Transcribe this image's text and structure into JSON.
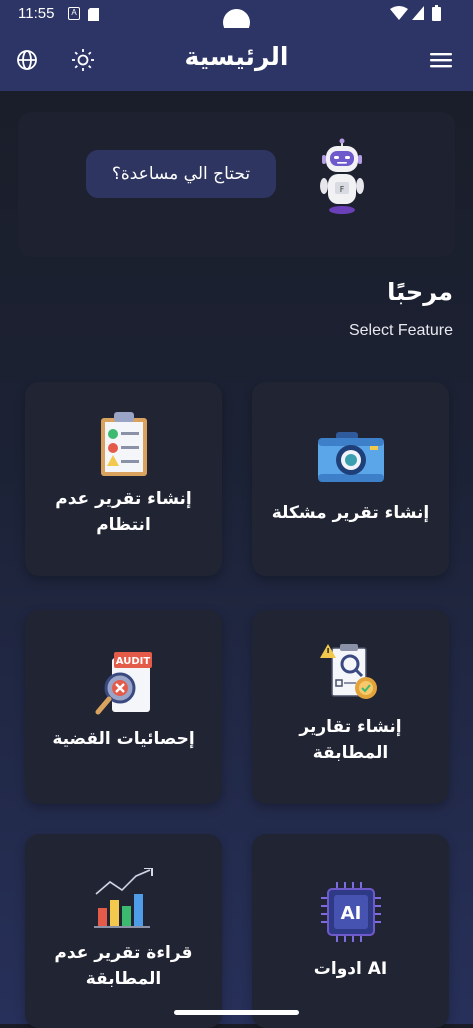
{
  "status_bar": {
    "time": "11:55",
    "notif_a": "A"
  },
  "app_bar": {
    "title": "الرئيسية"
  },
  "help": {
    "bubble_text": "تحتاج الي مساعدة؟"
  },
  "welcome": {
    "title": "مرحبًا",
    "subtitle": "Select Feature"
  },
  "features": [
    {
      "label": "إنشاء تقرير مشكلة",
      "icon": "camera-icon"
    },
    {
      "label": "إنشاء تقرير عدم انتظام",
      "icon": "clipboard-checklist-icon"
    },
    {
      "label": "إنشاء تقارير المطابقة",
      "icon": "compliance-document-icon"
    },
    {
      "label": "إحصائيات القضية",
      "icon": "audit-search-icon"
    },
    {
      "label": "AI ادوات",
      "icon": "ai-chip-icon"
    },
    {
      "label": "قراءة تقرير عدم المطابقة",
      "icon": "bar-chart-icon"
    }
  ],
  "colors": {
    "app_bar": "#2c3566",
    "card": "#202433",
    "bubble": "#2d3560"
  }
}
